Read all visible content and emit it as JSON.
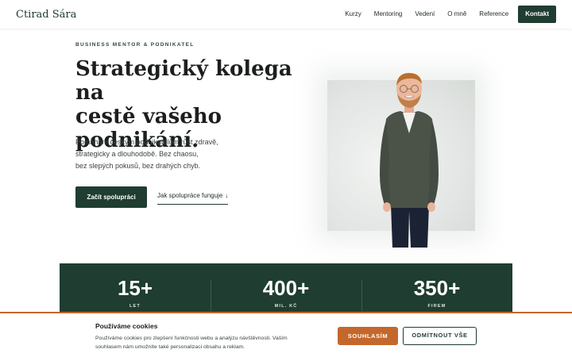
{
  "header": {
    "logo": "Ctirad Sára",
    "nav": [
      "Kurzy",
      "Mentoring",
      "Vedení",
      "O mně",
      "Reference"
    ],
    "cta": "Kontakt"
  },
  "hero": {
    "eyebrow": "BUSINESS MENTOR & PODNIKATEL",
    "title_lines": [
      "Strategický kolega na",
      "cestě vašeho",
      "podnikání."
    ],
    "subtitle_lines": [
      "Pomáhám českým podnikatelům růst zdravě,",
      "strategicky a dlouhodobě. Bez chaosu,",
      "bez slepých pokusů, bez drahých chyb."
    ],
    "primary_button": "Začít spolupráci",
    "secondary_link": "Jak spolupráce funguje",
    "secondary_link_arrow": "↓"
  },
  "stats": [
    {
      "value": "15+",
      "label": "LET"
    },
    {
      "value": "400+",
      "label": "MIL. KČ"
    },
    {
      "value": "350+",
      "label": "FIREM"
    }
  ],
  "cookie": {
    "title": "Používáme cookies",
    "text_lines": [
      "Používáme cookies pro zlepšení funkčnosti webu a analýzu návštěvnosti. Vaším",
      "souhlasem nám umožníte také personalizaci obsahu a reklam."
    ],
    "accept": "SOUHLASÍM",
    "decline": "ODMÍTNOUT VŠE"
  },
  "colors": {
    "brand_green": "#1f3d31",
    "accent_orange": "#c4672c"
  }
}
